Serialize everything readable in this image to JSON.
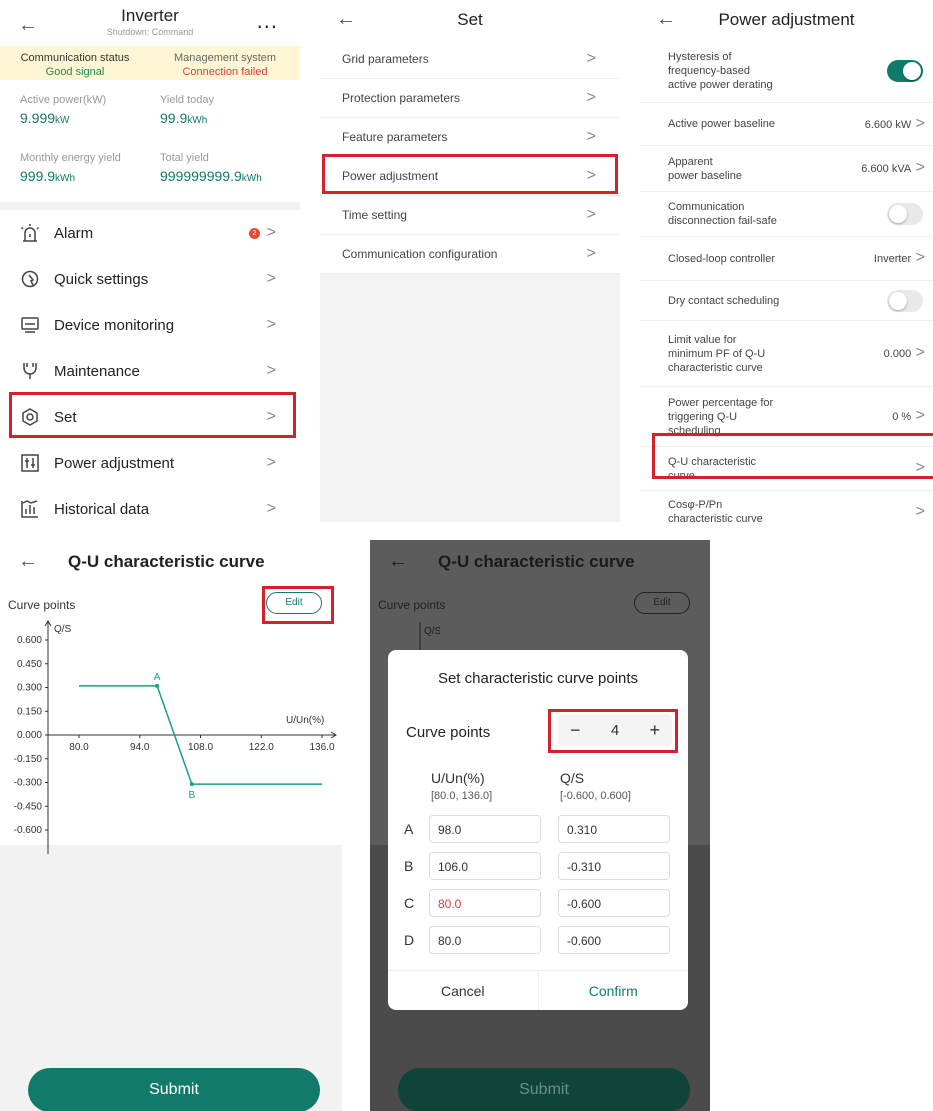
{
  "panel1": {
    "title": "Inverter",
    "subtitle": "Shutdown: Command",
    "more": "...",
    "status": [
      {
        "label": "Communication status",
        "value": "Good signal",
        "color": "#1f8a4c"
      },
      {
        "label": "Management system",
        "value": "Connection failed",
        "color": "#e23a3a"
      }
    ],
    "kpis": [
      {
        "label": "Active power(kW)",
        "value": "9.999",
        "unit": "kW"
      },
      {
        "label": "Yield today",
        "value": "99.9",
        "unit": "kWh"
      },
      {
        "label": "Monthly energy yield",
        "value": "999.9",
        "unit": "kWh"
      },
      {
        "label": "Total yield",
        "value": "999999999.9",
        "unit": "kWh"
      }
    ],
    "menu": [
      {
        "label": "Alarm",
        "badge": "2"
      },
      {
        "label": "Quick settings"
      },
      {
        "label": "Device monitoring"
      },
      {
        "label": "Maintenance"
      },
      {
        "label": "Set"
      },
      {
        "label": "Power adjustment"
      },
      {
        "label": "Historical data"
      }
    ]
  },
  "panel2": {
    "title": "Set",
    "items": [
      "Grid parameters",
      "Protection parameters",
      "Feature parameters",
      "Power adjustment",
      "Time setting",
      "Communication configuration"
    ]
  },
  "panel3": {
    "title": "Power adjustment",
    "rows": [
      {
        "label": "Hysteresis of frequency-based active power derating",
        "lines": [
          "Hysteresis of",
          "frequency-based",
          "active power derating"
        ],
        "type": "toggle",
        "on": true
      },
      {
        "label": "Active power baseline",
        "lines": [
          "Active power baseline"
        ],
        "value": "6.600 kW"
      },
      {
        "label": "Apparent power baseline",
        "lines": [
          "Apparent",
          "power baseline"
        ],
        "value": "6.600 kVA"
      },
      {
        "label": "Communication disconnection fail-safe",
        "lines": [
          "Communication",
          "disconnection fail-safe"
        ],
        "type": "toggle",
        "on": false
      },
      {
        "label": "Closed-loop controller",
        "lines": [
          "Closed-loop controller"
        ],
        "value": "Inverter"
      },
      {
        "label": "Dry contact scheduling",
        "lines": [
          "Dry contact scheduling"
        ],
        "type": "toggle",
        "on": false
      },
      {
        "label": "Limit value for minimum PF of Q-U characteristic curve",
        "lines": [
          "Limit value for",
          "minimum PF of Q-U",
          "characteristic curve"
        ],
        "value": "0.000"
      },
      {
        "label": "Power percentage for triggering Q-U scheduling",
        "lines": [
          "Power percentage for",
          "triggering Q-U",
          "scheduling"
        ],
        "value": "0 %"
      },
      {
        "label": "Q-U characteristic curve",
        "lines": [
          "Q-U characteristic",
          "curve"
        ],
        "value": ""
      },
      {
        "label": "Cosφ-P/Pn characteristic curve",
        "lines": [
          "Cosφ-P/Pn",
          "characteristic curve"
        ],
        "value": ""
      }
    ]
  },
  "panel4": {
    "title": "Q-U characteristic curve",
    "curve_points_label": "Curve points",
    "edit_label": "Edit",
    "submit_label": "Submit",
    "y_axis_label": "Q/S",
    "x_axis_label": "U/Un(%)",
    "y_ticks": [
      "0.600",
      "0.450",
      "0.300",
      "0.150",
      "0.000",
      "-0.150",
      "-0.300",
      "-0.450",
      "-0.600"
    ],
    "x_ticks": [
      "80.0",
      "94.0",
      "108.0",
      "122.0",
      "136.0"
    ],
    "points": [
      {
        "name": "A",
        "u": 98.0,
        "q": 0.31
      },
      {
        "name": "B",
        "u": 106.0,
        "q": -0.31
      }
    ],
    "line_start_u": 80.0,
    "line_end_u": 136.0,
    "curve_color": "#1aa08a"
  },
  "panel5": {
    "title": "Q-U characteristic curve",
    "curve_points_label": "Curve points",
    "y_axis_label": "Q/S",
    "edit_label": "Edit",
    "submit_label": "Submit",
    "dialog": {
      "title": "Set characteristic curve points",
      "curve_points_label": "Curve points",
      "count": "4",
      "minus": "−",
      "plus": "+",
      "col1_title": "U/Un(%)",
      "col1_range": "[80.0, 136.0]",
      "col2_title": "Q/S",
      "col2_range": "[-0.600, 0.600]",
      "rows": [
        {
          "name": "A",
          "u": "98.0",
          "q": "0.310"
        },
        {
          "name": "B",
          "u": "106.0",
          "q": "-0.310"
        },
        {
          "name": "C",
          "u": "80.0",
          "q": "-0.600",
          "u_error": true
        },
        {
          "name": "D",
          "u": "80.0",
          "q": "-0.600"
        }
      ],
      "cancel_label": "Cancel",
      "confirm_label": "Confirm"
    }
  },
  "colors": {
    "accent": "#127a6a",
    "highlight": "#d6202b"
  }
}
